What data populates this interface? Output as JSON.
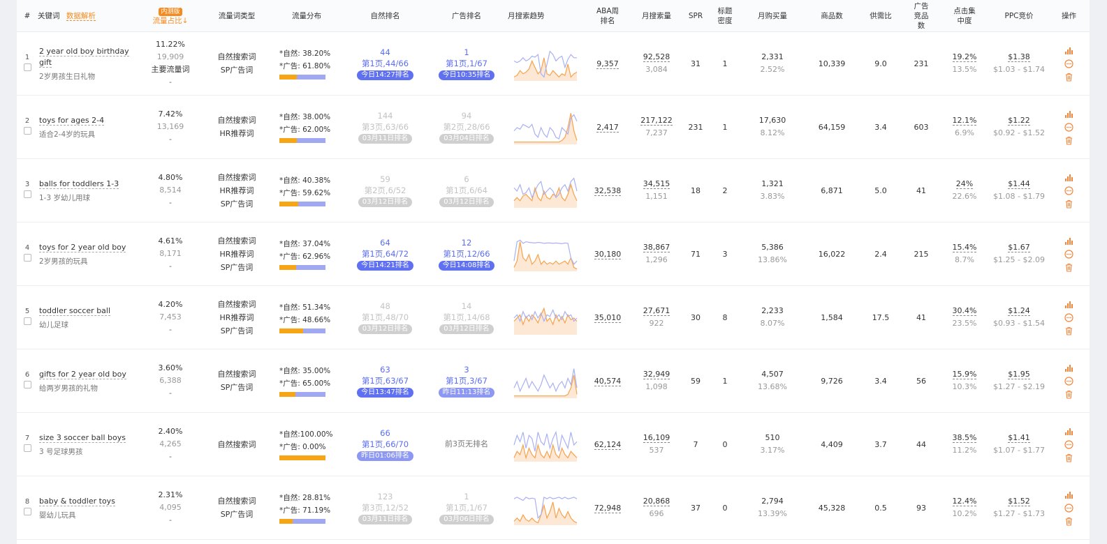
{
  "headers": {
    "num": "#",
    "keyword": "关键词",
    "data_explain": "数据解析",
    "badge": "内测版",
    "share": "流量占比↓",
    "type": "流量词类型",
    "flow": "流量分布",
    "organic": "自然排名",
    "ad": "广告排名",
    "trend": "月搜索趋势",
    "aba": "ABA周排名",
    "search": "月搜索量",
    "spr": "SPR",
    "title_density": "标题密度",
    "purchase": "月购买量",
    "products": "商品数",
    "supply": "供需比",
    "ad_products": "广告竞品数",
    "click": "点击集中度",
    "ppc": "PPC竞价",
    "ops": "操作"
  },
  "rows": [
    {
      "idx": "1",
      "en": "2 year old boy birthday gift",
      "zh": "2岁男孩生日礼物",
      "pct": "11.22%",
      "cnt": "19,909",
      "special": "主要流量词",
      "dash": "-",
      "types": [
        "自然搜索词",
        "SP广告词"
      ],
      "nat": "*自然: 38.20%",
      "ad": "*广告: 61.80%",
      "nat_frac": 0.382,
      "org": {
        "style": "blue",
        "a": "44",
        "b": "第1页,44/66",
        "pill": "今日14:27排名"
      },
      "adr": {
        "style": "blue",
        "a": "1",
        "b": "第1页,1/67",
        "pill": "今日10:35排名"
      },
      "aba": "9,357",
      "search": "92,528",
      "search2": "3,084",
      "spr": "31",
      "td": "1",
      "pur": "2,331",
      "pur2": "2.52%",
      "prod": "10,339",
      "sup": "9.0",
      "adp": "231",
      "clk": "19.2%",
      "clk2": "13.5%",
      "ppc": "$1.38",
      "ppc2": "$1.03 - $1.74",
      "trend_blue": [
        0.6,
        0.55,
        0.6,
        0.7,
        0.6,
        0.65,
        0.75,
        0.72,
        0.8,
        0.2,
        0.1,
        0.5,
        0.9,
        0.8,
        0.6,
        0.7,
        0.75,
        0.4,
        0.65,
        0.8,
        0.7,
        0.7
      ],
      "trend_orange": [
        0.1,
        0.15,
        0.3,
        0.2,
        0.25,
        0.35,
        0.6,
        0.4,
        0.2,
        0.3,
        0.7,
        0.2,
        0.15,
        0.3,
        0.2,
        0.1,
        0.2,
        0.15,
        0.5,
        0.1,
        0.2,
        0.25
      ]
    },
    {
      "idx": "2",
      "en": "toys for ages 2-4",
      "zh": "适合2-4岁的玩具",
      "pct": "7.42%",
      "cnt": "13,169",
      "special": "",
      "dash": "-",
      "types": [
        "自然搜索词",
        "HR推荐词"
      ],
      "nat": "*自然: 38.00%",
      "ad": "*广告: 62.00%",
      "nat_frac": 0.38,
      "org": {
        "style": "grey",
        "a": "144",
        "b": "第3页,63/66",
        "pill": "03月11日排名"
      },
      "adr": {
        "style": "grey",
        "a": "94",
        "b": "第2页,28/66",
        "pill": "03月04日排名"
      },
      "aba": "2,417",
      "search": "217,122",
      "search2": "7,237",
      "spr": "231",
      "td": "1",
      "pur": "17,630",
      "pur2": "8.12%",
      "prod": "64,159",
      "sup": "3.4",
      "adp": "603",
      "clk": "12.1%",
      "clk2": "6.9%",
      "ppc": "$1.22",
      "ppc2": "$0.92 - $1.52",
      "trend_blue": [
        0.4,
        0.5,
        0.45,
        0.6,
        0.55,
        0.5,
        0.6,
        0.3,
        0.2,
        0.5,
        0.3,
        0.2,
        0.5,
        0.4,
        0.2,
        0.15,
        0.5,
        0.4,
        0.3,
        0.8,
        0.9,
        0.7
      ],
      "trend_orange": [
        0.05,
        0.05,
        0.05,
        0.05,
        0.05,
        0.05,
        0.05,
        0.05,
        0.05,
        0.05,
        0.05,
        0.05,
        0.05,
        0.05,
        0.05,
        0.05,
        0.1,
        0.2,
        0.5,
        0.95,
        0.4,
        0.1
      ]
    },
    {
      "idx": "3",
      "en": "balls for toddlers 1-3",
      "zh": "1-3 岁幼儿用球",
      "pct": "4.80%",
      "cnt": "8,514",
      "special": "",
      "dash": "-",
      "types": [
        "自然搜索词",
        "HR推荐词",
        "SP广告词"
      ],
      "nat": "*自然: 40.38%",
      "ad": "*广告: 59.62%",
      "nat_frac": 0.4038,
      "org": {
        "style": "grey",
        "a": "59",
        "b": "第2页,6/52",
        "pill": "03月12日排名"
      },
      "adr": {
        "style": "grey",
        "a": "6",
        "b": "第1页,6/64",
        "pill": "03月12日排名"
      },
      "aba": "32,538",
      "search": "34,515",
      "search2": "1,151",
      "spr": "18",
      "td": "2",
      "pur": "1,321",
      "pur2": "3.83%",
      "prod": "6,871",
      "sup": "5.0",
      "adp": "41",
      "clk": "24%",
      "clk2": "22.6%",
      "ppc": "$1.44",
      "ppc2": "$1.08 - $1.79",
      "trend_blue": [
        0.6,
        0.5,
        0.7,
        0.4,
        0.45,
        0.6,
        0.3,
        0.5,
        0.7,
        0.8,
        0.4,
        0.5,
        0.6,
        0.5,
        0.3,
        0.4,
        0.6,
        0.7,
        0.5,
        0.8,
        0.9,
        0.5
      ],
      "trend_orange": [
        0.2,
        0.3,
        0.2,
        0.35,
        0.4,
        0.3,
        0.2,
        0.6,
        0.3,
        0.2,
        0.5,
        0.3,
        0.25,
        0.4,
        0.35,
        0.6,
        0.3,
        0.2,
        0.4,
        0.7,
        0.4,
        0.2
      ]
    },
    {
      "idx": "4",
      "en": "toys for 2 year old boy",
      "zh": "2岁男孩的玩具",
      "pct": "4.61%",
      "cnt": "8,171",
      "special": "",
      "dash": "-",
      "types": [
        "自然搜索词",
        "HR推荐词",
        "SP广告词"
      ],
      "nat": "*自然: 37.04%",
      "ad": "*广告: 62.96%",
      "nat_frac": 0.3704,
      "org": {
        "style": "blue",
        "a": "64",
        "b": "第1页,64/72",
        "pill": "今日14:21排名"
      },
      "adr": {
        "style": "blue",
        "a": "12",
        "b": "第1页,12/66",
        "pill": "今日14:08排名"
      },
      "aba": "30,180",
      "search": "38,867",
      "search2": "1,296",
      "spr": "71",
      "td": "3",
      "pur": "5,386",
      "pur2": "13.86%",
      "prod": "16,022",
      "sup": "2.4",
      "adp": "215",
      "clk": "15.4%",
      "clk2": "8.7%",
      "ppc": "$1.67",
      "ppc2": "$1.25 - $2.09",
      "trend_blue": [
        0.3,
        0.9,
        0.95,
        0.85,
        0.9,
        0.88,
        0.87,
        0.86,
        0.88,
        0.87,
        0.85,
        0.86,
        0.86,
        0.85,
        0.86,
        0.85,
        0.84,
        0.86,
        0.85,
        0.4,
        0.2,
        0.3
      ],
      "trend_orange": [
        0.1,
        0.3,
        0.9,
        0.4,
        0.3,
        0.5,
        0.2,
        0.3,
        0.5,
        0.2,
        0.3,
        0.2,
        0.25,
        0.2,
        0.3,
        0.2,
        0.25,
        0.3,
        0.2,
        0.4,
        0.1,
        0.05
      ]
    },
    {
      "idx": "5",
      "en": "toddler soccer ball",
      "zh": "幼儿足球",
      "pct": "4.20%",
      "cnt": "7,453",
      "special": "",
      "dash": "-",
      "types": [
        "自然搜索词",
        "HR推荐词",
        "SP广告词"
      ],
      "nat": "*自然: 51.34%",
      "ad": "*广告: 48.66%",
      "nat_frac": 0.5134,
      "org": {
        "style": "grey",
        "a": "48",
        "b": "第1页,48/70",
        "pill": "03月12日排名"
      },
      "adr": {
        "style": "grey",
        "a": "14",
        "b": "第1页,14/68",
        "pill": "03月12日排名"
      },
      "aba": "35,010",
      "search": "27,671",
      "search2": "922",
      "spr": "30",
      "td": "8",
      "pur": "2,233",
      "pur2": "8.07%",
      "prod": "1,584",
      "sup": "17.5",
      "adp": "41",
      "clk": "30.4%",
      "clk2": "23.5%",
      "ppc": "$1.24",
      "ppc2": "$0.93 - $1.54",
      "trend_blue": [
        0.5,
        0.6,
        0.4,
        0.7,
        0.5,
        0.6,
        0.45,
        0.7,
        0.5,
        0.65,
        0.4,
        0.6,
        0.55,
        0.75,
        0.5,
        0.6,
        0.45,
        0.7,
        0.55,
        0.6,
        0.4,
        0.5
      ],
      "trend_orange": [
        0.4,
        0.5,
        0.6,
        0.3,
        0.55,
        0.4,
        0.6,
        0.5,
        0.35,
        0.6,
        0.8,
        0.4,
        0.5,
        0.3,
        0.6,
        0.4,
        0.55,
        0.35,
        0.6,
        0.45,
        0.5,
        0.4
      ]
    },
    {
      "idx": "6",
      "en": "gifts for 2 year old boy",
      "zh": "给两岁男孩的礼物",
      "pct": "3.60%",
      "cnt": "6,388",
      "special": "",
      "dash": "-",
      "types": [
        "自然搜索词",
        "SP广告词"
      ],
      "nat": "*自然: 35.00%",
      "ad": "*广告: 65.00%",
      "nat_frac": 0.35,
      "org": {
        "style": "blue",
        "a": "63",
        "b": "第1页,63/67",
        "pill": "今日13:47排名"
      },
      "adr": {
        "style": "lblue",
        "a": "3",
        "b": "第1页,3/67",
        "pill": "昨日11:13排名"
      },
      "aba": "40,574",
      "search": "32,949",
      "search2": "1,098",
      "spr": "59",
      "td": "1",
      "pur": "4,507",
      "pur2": "13.68%",
      "prod": "9,726",
      "sup": "3.4",
      "adp": "56",
      "clk": "15.9%",
      "clk2": "10.3%",
      "ppc": "$1.95",
      "ppc2": "$1.27 - $2.19",
      "trend_blue": [
        0.3,
        0.5,
        0.2,
        0.4,
        0.6,
        0.3,
        0.5,
        0.35,
        0.2,
        0.4,
        0.7,
        0.5,
        0.3,
        0.45,
        0.2,
        0.4,
        0.5,
        0.3,
        0.6,
        0.4,
        0.9,
        0.3
      ],
      "trend_orange": [
        0.05,
        0.05,
        0.05,
        0.05,
        0.05,
        0.05,
        0.05,
        0.05,
        0.05,
        0.05,
        0.05,
        0.05,
        0.05,
        0.05,
        0.05,
        0.05,
        0.05,
        0.05,
        0.1,
        0.3,
        0.7,
        0.1
      ]
    },
    {
      "idx": "7",
      "en": "size 3 soccer ball boys",
      "zh": "3 号足球男孩",
      "pct": "2.40%",
      "cnt": "4,265",
      "special": "",
      "dash": "-",
      "types": [
        "自然搜索词"
      ],
      "nat": "*自然:100.00%",
      "ad": "*广告: 0.00%",
      "nat_frac": 1.0,
      "org": {
        "style": "lblue",
        "a": "66",
        "b": "第1页,66/70",
        "pill": "昨日01:06排名"
      },
      "adr": {
        "style": "none",
        "a": "前3页无排名",
        "b": "",
        "pill": ""
      },
      "aba": "62,124",
      "search": "16,109",
      "search2": "537",
      "spr": "7",
      "td": "0",
      "pur": "510",
      "pur2": "3.17%",
      "prod": "4,409",
      "sup": "3.7",
      "adp": "44",
      "clk": "38.5%",
      "clk2": "11.2%",
      "ppc": "$1.41",
      "ppc2": "$1.07 - $1.77",
      "trend_blue": [
        0.5,
        0.8,
        0.6,
        0.9,
        0.4,
        0.8,
        0.7,
        0.3,
        0.9,
        0.6,
        0.5,
        0.85,
        0.4,
        0.7,
        0.9,
        0.3,
        0.8,
        0.6,
        0.4,
        0.9,
        0.5,
        0.6
      ],
      "trend_orange": [
        0.1,
        0.3,
        0.2,
        0.5,
        0.1,
        0.4,
        0.2,
        0.1,
        0.5,
        0.2,
        0.1,
        0.3,
        0.1,
        0.5,
        0.2,
        0.1,
        0.4,
        0.2,
        0.1,
        0.3,
        0.2,
        0.1
      ]
    },
    {
      "idx": "8",
      "en": "baby & toddler toys",
      "zh": "婴幼儿玩具",
      "pct": "2.31%",
      "cnt": "4,095",
      "special": "",
      "dash": "-",
      "types": [
        "自然搜索词",
        "SP广告词"
      ],
      "nat": "*自然: 28.81%",
      "ad": "*广告: 71.19%",
      "nat_frac": 0.2881,
      "org": {
        "style": "grey",
        "a": "123",
        "b": "第3页,12/52",
        "pill": "03月11日排名"
      },
      "adr": {
        "style": "grey",
        "a": "1",
        "b": "第1页,1/67",
        "pill": "03月06日排名"
      },
      "aba": "72,948",
      "search": "20,868",
      "search2": "696",
      "spr": "37",
      "td": "0",
      "pur": "2,794",
      "pur2": "13.39%",
      "prod": "45,328",
      "sup": "0.5",
      "adp": "93",
      "clk": "12.4%",
      "clk2": "10.2%",
      "ppc": "$1.52",
      "ppc2": "$1.27 - $1.73",
      "trend_blue": [
        0.8,
        0.85,
        0.8,
        0.75,
        0.85,
        0.8,
        0.82,
        0.8,
        0.2,
        0.3,
        0.85,
        0.8,
        0.85,
        0.8,
        0.82,
        0.85,
        0.8,
        0.85,
        0.8,
        0.82,
        0.85,
        0.8
      ],
      "trend_orange": [
        0.1,
        0.2,
        0.1,
        0.3,
        0.15,
        0.1,
        0.2,
        0.1,
        0.05,
        0.3,
        0.6,
        0.2,
        0.4,
        0.7,
        0.2,
        0.5,
        0.3,
        0.2,
        0.4,
        0.2,
        0.1,
        0.05
      ]
    }
  ],
  "colors": {
    "blue_series": "#a9b0f4",
    "orange_series": "#f7a24a",
    "orange_fill": "#fde8d6",
    "icon": "#f4853a"
  },
  "icons": {
    "chart": "bar-chart-icon",
    "more": "more-circle-icon",
    "delete": "trash-icon"
  }
}
